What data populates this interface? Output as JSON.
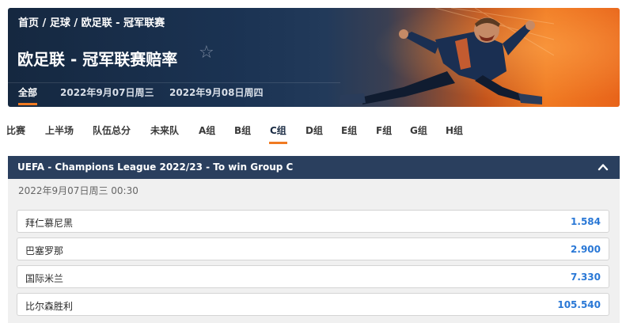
{
  "breadcrumb": {
    "home": "首页",
    "sep1": " / ",
    "sport": "足球",
    "sep2": " / ",
    "league": "欧足联 - 冠军联赛"
  },
  "page": {
    "title": "欧足联 - 冠军联赛赔率",
    "favorite_icon": "star-icon"
  },
  "date_tabs": [
    {
      "label": "全部",
      "active": true
    },
    {
      "label": "2022年9月07日周三",
      "active": false
    },
    {
      "label": "2022年9月08日周四",
      "active": false
    }
  ],
  "group_tabs": [
    {
      "label": "比赛"
    },
    {
      "label": "上半场"
    },
    {
      "label": "队伍总分"
    },
    {
      "label": "未来队"
    },
    {
      "label": "A组"
    },
    {
      "label": "B组"
    },
    {
      "label": "C组",
      "active": true
    },
    {
      "label": "D组"
    },
    {
      "label": "E组"
    },
    {
      "label": "F组"
    },
    {
      "label": "G组"
    },
    {
      "label": "H组"
    }
  ],
  "market": {
    "title": "UEFA - Champions League 2022/23 - To win Group C",
    "collapse_icon": "chevron-up-icon",
    "datetime": "2022年9月07日周三 00:30",
    "selections": [
      {
        "name": "拜仁慕尼黑",
        "price": "1.584"
      },
      {
        "name": "巴塞罗那",
        "price": "2.900"
      },
      {
        "name": "国际米兰",
        "price": "7.330"
      },
      {
        "name": "比尔森胜利",
        "price": "105.540"
      }
    ]
  },
  "colors": {
    "header_dark": "#1b3353",
    "accent_orange": "#f07a22",
    "market_header": "#2a3f5e",
    "price_blue": "#2a78d6"
  }
}
